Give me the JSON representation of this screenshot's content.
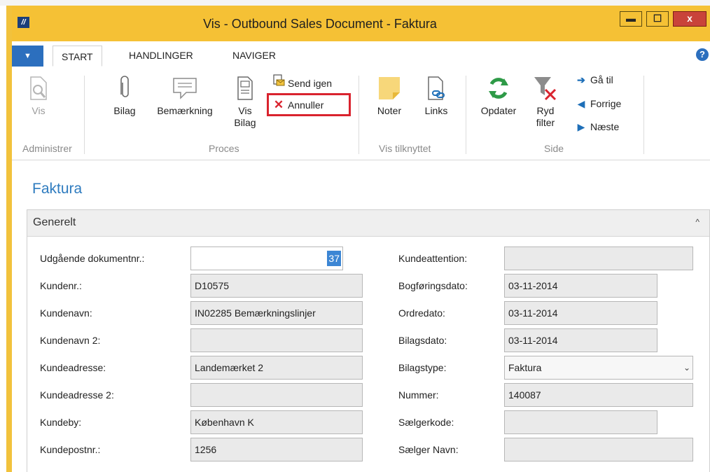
{
  "window": {
    "title": "Vis - Outbound Sales Document - Faktura",
    "min": "▬",
    "max": "☐",
    "close": "x"
  },
  "ribbon": {
    "file_menu": "▼",
    "tabs": [
      "START",
      "HANDLINGER",
      "NAVIGER"
    ],
    "help": "?",
    "buttons": {
      "vis": "Vis",
      "bilag": "Bilag",
      "bemaerkning": "Bemærkning",
      "vis_bilag_1": "Vis",
      "vis_bilag_2": "Bilag",
      "send_igen": "Send igen",
      "annuller": "Annuller",
      "noter": "Noter",
      "links": "Links",
      "opdater": "Opdater",
      "ryd_filter_1": "Ryd",
      "ryd_filter_2": "filter",
      "ga_til": "Gå til",
      "forrige": "Forrige",
      "naeste": "Næste"
    },
    "groups": {
      "administrer": "Administrer",
      "proces": "Proces",
      "vis_tilknyttet": "Vis tilknyttet",
      "side": "Side"
    }
  },
  "page": {
    "title": "Faktura"
  },
  "fasttab": {
    "label": "Generelt",
    "chevron": "^"
  },
  "fields": {
    "udgaaende_dokumentnr": {
      "label": "Udgående dokumentnr.:",
      "value": "37"
    },
    "kundenr": {
      "label": "Kundenr.:",
      "value": "D10575"
    },
    "kundenavn": {
      "label": "Kundenavn:",
      "value": "IN02285 Bemærkningslinjer"
    },
    "kundenavn2": {
      "label": "Kundenavn 2:",
      "value": ""
    },
    "kundeadresse": {
      "label": "Kundeadresse:",
      "value": "Landemærket 2"
    },
    "kundeadresse2": {
      "label": "Kundeadresse 2:",
      "value": ""
    },
    "kundeby": {
      "label": "Kundeby:",
      "value": "København K"
    },
    "kundepostnr": {
      "label": "Kundepostnr.:",
      "value": "1256"
    },
    "kundeattention": {
      "label": "Kundeattention:",
      "value": ""
    },
    "bogfoeringsdato": {
      "label": "Bogføringsdato:",
      "value": "03-11-2014"
    },
    "ordredato": {
      "label": "Ordredato:",
      "value": "03-11-2014"
    },
    "bilagsdato": {
      "label": "Bilagsdato:",
      "value": "03-11-2014"
    },
    "bilagstype": {
      "label": "Bilagstype:",
      "value": "Faktura",
      "arrow": "⌄"
    },
    "nummer": {
      "label": "Nummer:",
      "value": "140087"
    },
    "saelgerkode": {
      "label": "Sælgerkode:",
      "value": ""
    },
    "saelger_navn": {
      "label": "Sælger Navn:",
      "value": ""
    }
  },
  "icons": [
    "app-icon",
    "magnifier-document-icon",
    "paperclip-icon",
    "comment-icon",
    "document-icon",
    "send-mail-icon",
    "cancel-x-icon",
    "note-icon",
    "link-document-icon",
    "refresh-icon",
    "clear-filter-icon",
    "arrow-right-icon",
    "triangle-left-icon",
    "triangle-right-icon"
  ],
  "colors": {
    "title_bar": "#f5c135",
    "accent_blue": "#2c6fbe",
    "highlight_box": "#d9232e",
    "cancel_red": "#d9232e",
    "refresh_green": "#2e9a47"
  }
}
